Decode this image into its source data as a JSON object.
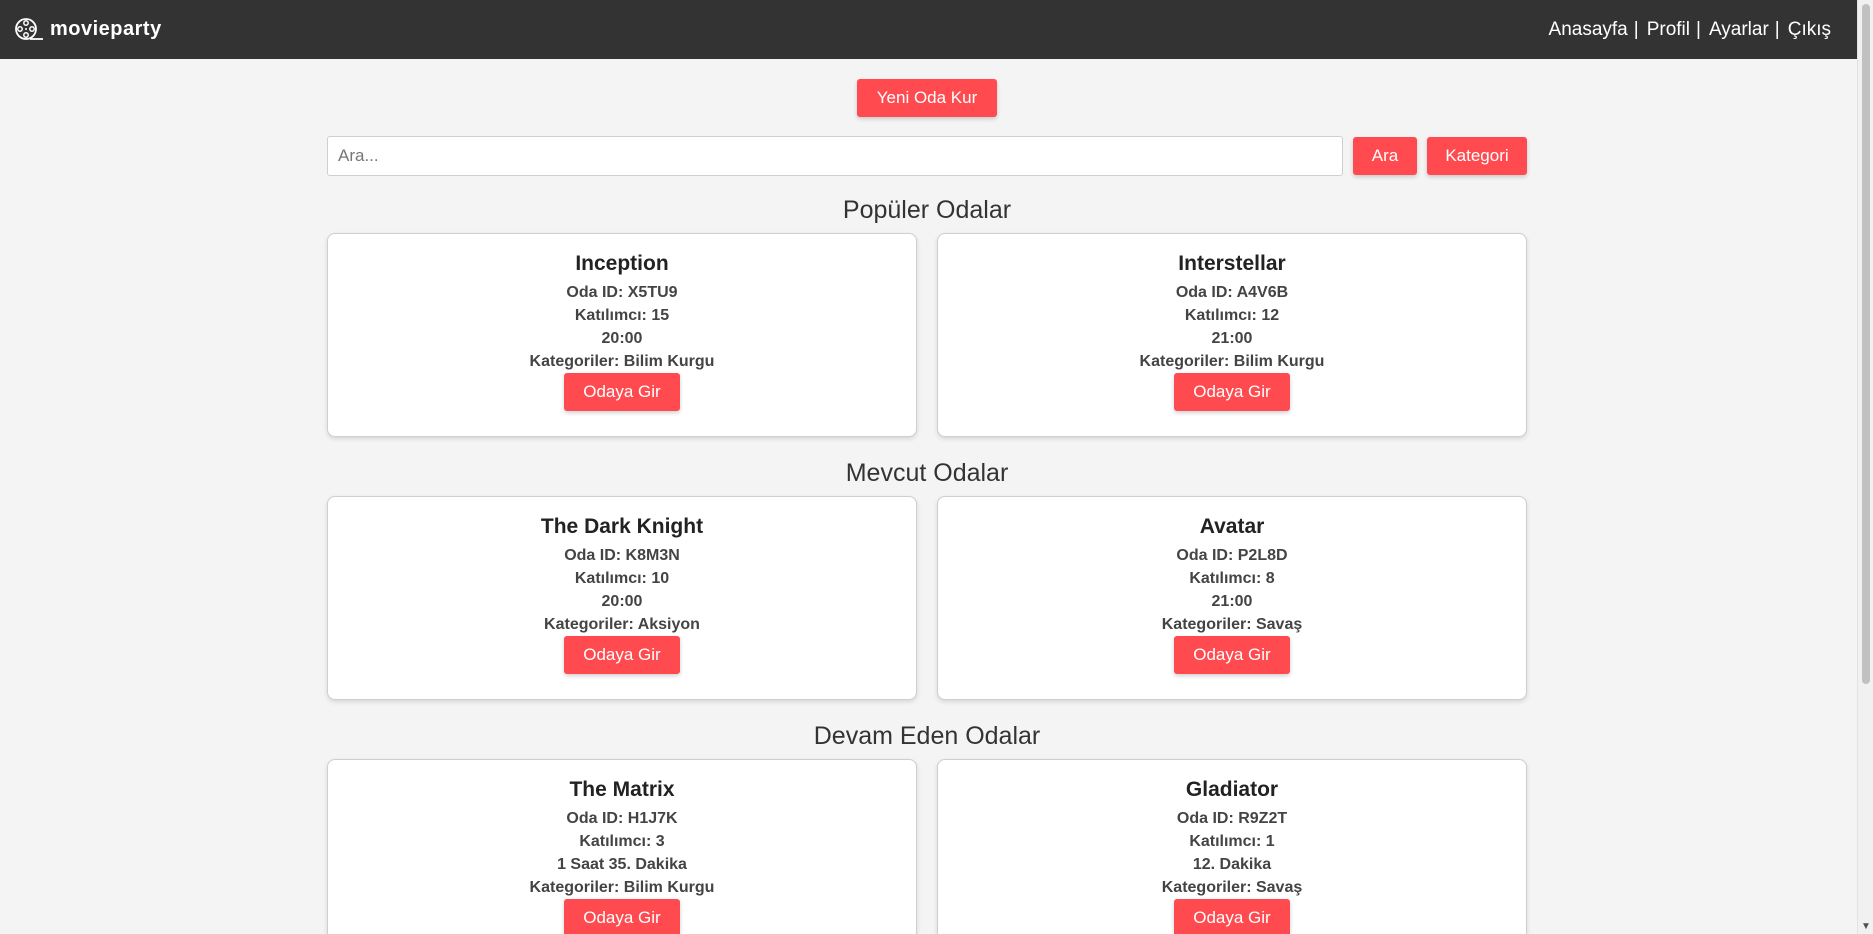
{
  "navbar": {
    "brand": "movieparty",
    "links": [
      {
        "label": "Anasayfa",
        "sep": "|"
      },
      {
        "label": "Profil",
        "sep": "|"
      },
      {
        "label": "Ayarlar",
        "sep": "|"
      },
      {
        "label": "Çıkış",
        "sep": ""
      }
    ]
  },
  "actions": {
    "new_room": "Yeni Oda Kur",
    "search_placeholder": "Ara...",
    "search_button": "Ara",
    "category_button": "Kategori"
  },
  "sections": [
    {
      "title": "Popüler Odalar",
      "rooms": [
        {
          "title": "Inception",
          "room_id": "Oda ID: X5TU9",
          "participants": "Katılımcı: 15",
          "time": "20:00",
          "categories": "Kategoriler: Bilim Kurgu",
          "button": "Odaya Gir"
        },
        {
          "title": "Interstellar",
          "room_id": "Oda ID: A4V6B",
          "participants": "Katılımcı: 12",
          "time": "21:00",
          "categories": "Kategoriler: Bilim Kurgu",
          "button": "Odaya Gir"
        }
      ]
    },
    {
      "title": "Mevcut Odalar",
      "rooms": [
        {
          "title": "The Dark Knight",
          "room_id": "Oda ID: K8M3N",
          "participants": "Katılımcı: 10",
          "time": "20:00",
          "categories": "Kategoriler: Aksiyon",
          "button": "Odaya Gir"
        },
        {
          "title": "Avatar",
          "room_id": "Oda ID: P2L8D",
          "participants": "Katılımcı: 8",
          "time": "21:00",
          "categories": "Kategoriler: Savaş",
          "button": "Odaya Gir"
        }
      ]
    },
    {
      "title": "Devam Eden Odalar",
      "rooms": [
        {
          "title": "The Matrix",
          "room_id": "Oda ID: H1J7K",
          "participants": "Katılımcı: 3",
          "time": "1 Saat 35. Dakika",
          "categories": "Kategoriler: Bilim Kurgu",
          "button": "Odaya Gir"
        },
        {
          "title": "Gladiator",
          "room_id": "Oda ID: R9Z2T",
          "participants": "Katılımcı: 1",
          "time": "12. Dakika",
          "categories": "Kategoriler: Savaş",
          "button": "Odaya Gir"
        }
      ]
    }
  ],
  "colors": {
    "navbar": "#333333",
    "accent": "#ff4a4f",
    "background": "#f4f4f4"
  }
}
